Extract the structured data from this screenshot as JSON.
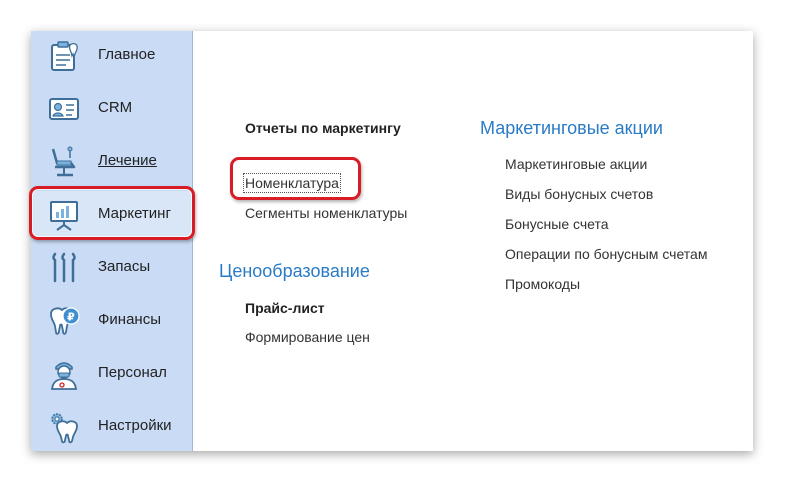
{
  "sidebar": {
    "items": [
      {
        "label": "Главное",
        "icon": "clipboard-tooth-icon"
      },
      {
        "label": "CRM",
        "icon": "contact-card-icon"
      },
      {
        "label": "Лечение",
        "icon": "dental-chair-icon"
      },
      {
        "label": "Маркетинг",
        "icon": "presentation-board-icon"
      },
      {
        "label": "Запасы",
        "icon": "dental-tools-icon"
      },
      {
        "label": "Финансы",
        "icon": "tooth-ruble-icon"
      },
      {
        "label": "Персонал",
        "icon": "doctor-icon"
      },
      {
        "label": "Настройки",
        "icon": "tooth-gear-icon"
      }
    ],
    "active_index": 3
  },
  "content": {
    "reports_section": {
      "title": "Отчеты по маркетингу",
      "links": [
        "Номенклатура",
        "Сегменты номенклатуры"
      ]
    },
    "pricing_section": {
      "title": "Ценообразование",
      "subtitle": "Прайс-лист",
      "links": [
        "Формирование цен"
      ]
    },
    "promotions_section": {
      "title": "Маркетинговые акции",
      "links": [
        "Маркетинговые акции",
        "Виды бонусных счетов",
        "Бонусные счета",
        "Операции по бонусным счетам",
        "Промокоды"
      ]
    }
  },
  "colors": {
    "sidebar_bg": "#c9dbf5",
    "heading_blue": "#2a7bc6",
    "highlight_red": "#d81c25"
  }
}
